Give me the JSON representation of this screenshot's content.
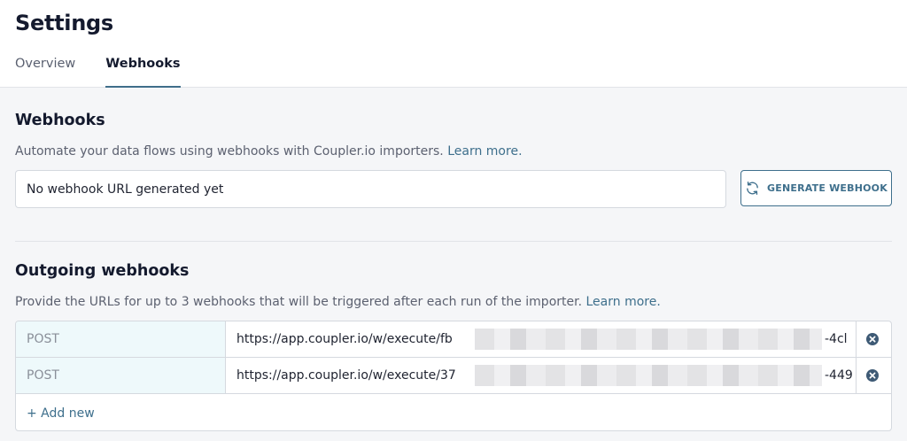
{
  "page": {
    "title": "Settings"
  },
  "tabs": [
    {
      "label": "Overview",
      "active": false
    },
    {
      "label": "Webhooks",
      "active": true
    }
  ],
  "webhooks": {
    "title": "Webhooks",
    "description": "Automate your data flows using webhooks with Coupler.io importers. ",
    "learn_more": "Learn more.",
    "url_value": "No webhook URL generated yet",
    "generate_label": "GENERATE WEBHOOK"
  },
  "outgoing": {
    "title": "Outgoing webhooks",
    "description": "Provide the URLs for up to 3 webhooks that will be triggered after each run of the importer. ",
    "learn_more": "Learn more.",
    "rows": [
      {
        "method": "POST",
        "url_prefix": "https://app.coupler.io/w/execute/fb",
        "url_suffix": "-4cl"
      },
      {
        "method": "POST",
        "url_prefix": "https://app.coupler.io/w/execute/37",
        "url_suffix": "-449"
      }
    ],
    "add_new": "+ Add new"
  },
  "colors": {
    "accent": "#3e6f8c",
    "method_bg": "#eef9fb",
    "content_bg": "#f5f6f8"
  }
}
